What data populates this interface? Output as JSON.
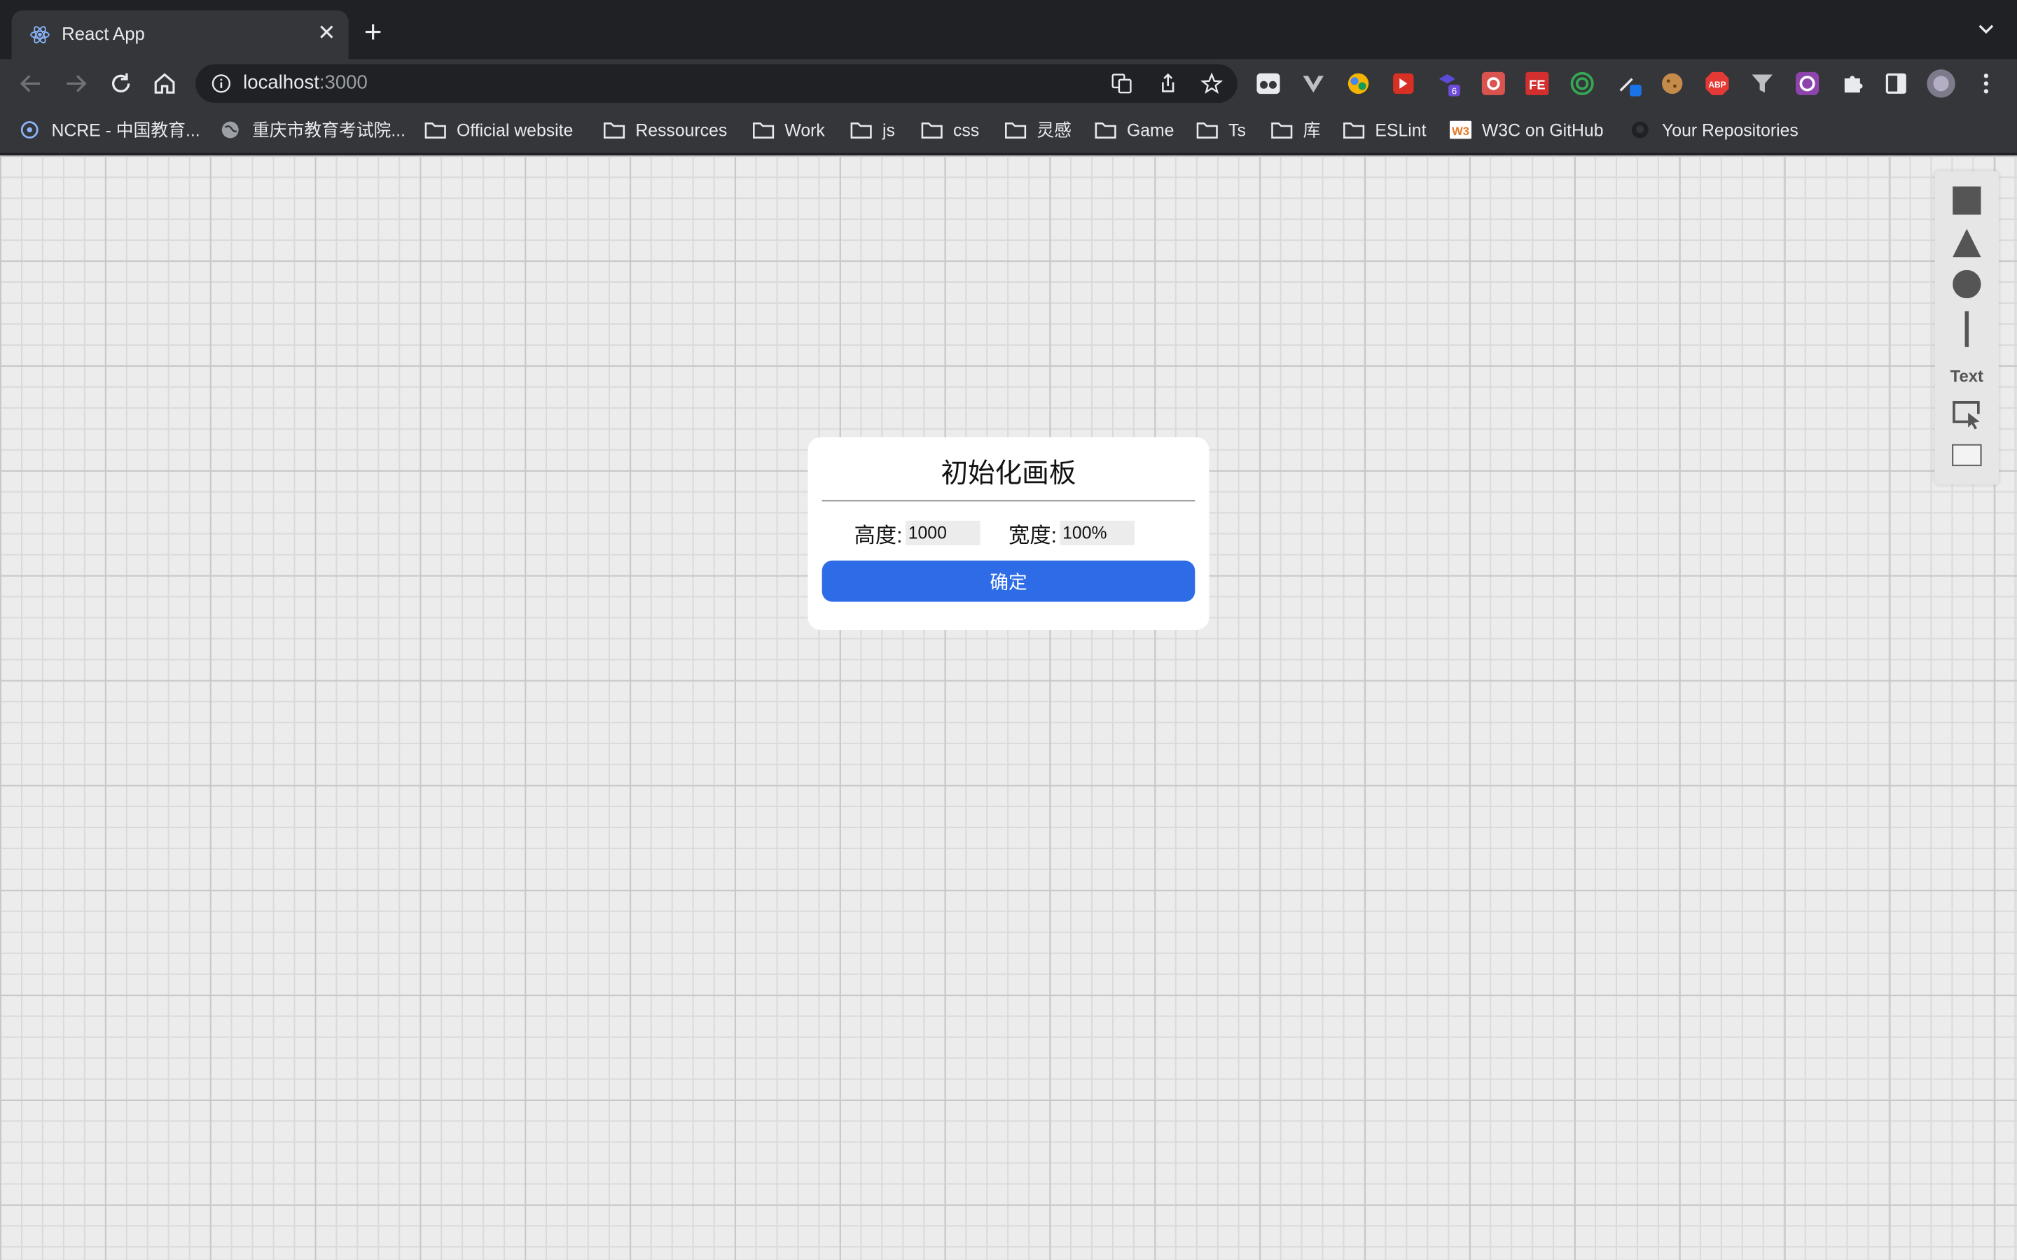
{
  "browser": {
    "tab": {
      "title": "React App",
      "close_glyph": "✕",
      "favicon": "react-icon"
    },
    "new_tab_glyph": "+",
    "address": {
      "host": "localhost",
      "port": ":3000"
    }
  },
  "bookmarks": [
    {
      "label": "NCRE - 中国教育...",
      "icon": "ncre-icon"
    },
    {
      "label": "重庆市教育考试院...",
      "icon": "globe-icon"
    },
    {
      "label": "Official website",
      "icon": "folder-icon"
    },
    {
      "label": "Ressources",
      "icon": "folder-icon"
    },
    {
      "label": "Work",
      "icon": "folder-icon"
    },
    {
      "label": "js",
      "icon": "folder-icon"
    },
    {
      "label": "css",
      "icon": "folder-icon"
    },
    {
      "label": "灵感",
      "icon": "folder-icon"
    },
    {
      "label": "Game",
      "icon": "folder-icon"
    },
    {
      "label": "Ts",
      "icon": "folder-icon"
    },
    {
      "label": "库",
      "icon": "folder-icon"
    },
    {
      "label": "ESLint",
      "icon": "folder-icon"
    },
    {
      "label": "W3C on GitHub",
      "icon": "w3c-icon"
    },
    {
      "label": "Your Repositories",
      "icon": "github-icon"
    }
  ],
  "dialog": {
    "title": "初始化画板",
    "height_label": "高度:",
    "height_value": "1000",
    "width_label": "宽度:",
    "width_value": "100%",
    "confirm_label": "确定"
  },
  "tools": {
    "text_label": "Text"
  },
  "colors": {
    "accent": "#2e6be6",
    "canvas_bg": "#ececec",
    "chrome_dark": "#202124",
    "chrome_toolbar": "#35363a"
  }
}
